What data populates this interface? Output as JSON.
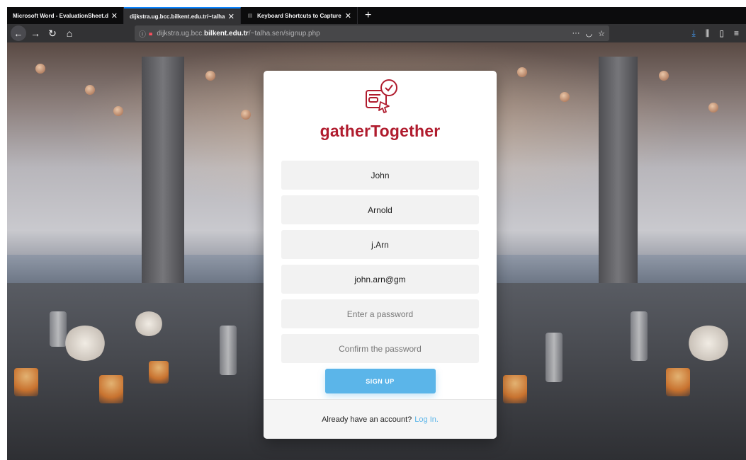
{
  "browser": {
    "tabs": [
      {
        "label": "Microsoft Word - EvaluationSheet.d",
        "active": false
      },
      {
        "label": "dijkstra.ug.bcc.bilkent.edu.tr/~talha",
        "active": true
      },
      {
        "label": "Keyboard Shortcuts to Capture",
        "active": false
      }
    ],
    "url_prefix": "dijkstra.ug.bcc.",
    "url_domain": "bilkent.edu.tr",
    "url_path": "/~talha.sen/signup.php"
  },
  "signup": {
    "brand": "gatherTogether",
    "brand_color": "#b01c2e",
    "first_name": "John",
    "last_name": "Arnold",
    "username": "j.Arn",
    "email": "john.arn@gm",
    "password_placeholder": "Enter a password",
    "confirm_placeholder": "Confirm the password",
    "signup_label": "SIGN UP",
    "footer_text": "Already have an account?",
    "login_link": "Log In.",
    "accent_color": "#5bb5e9"
  }
}
